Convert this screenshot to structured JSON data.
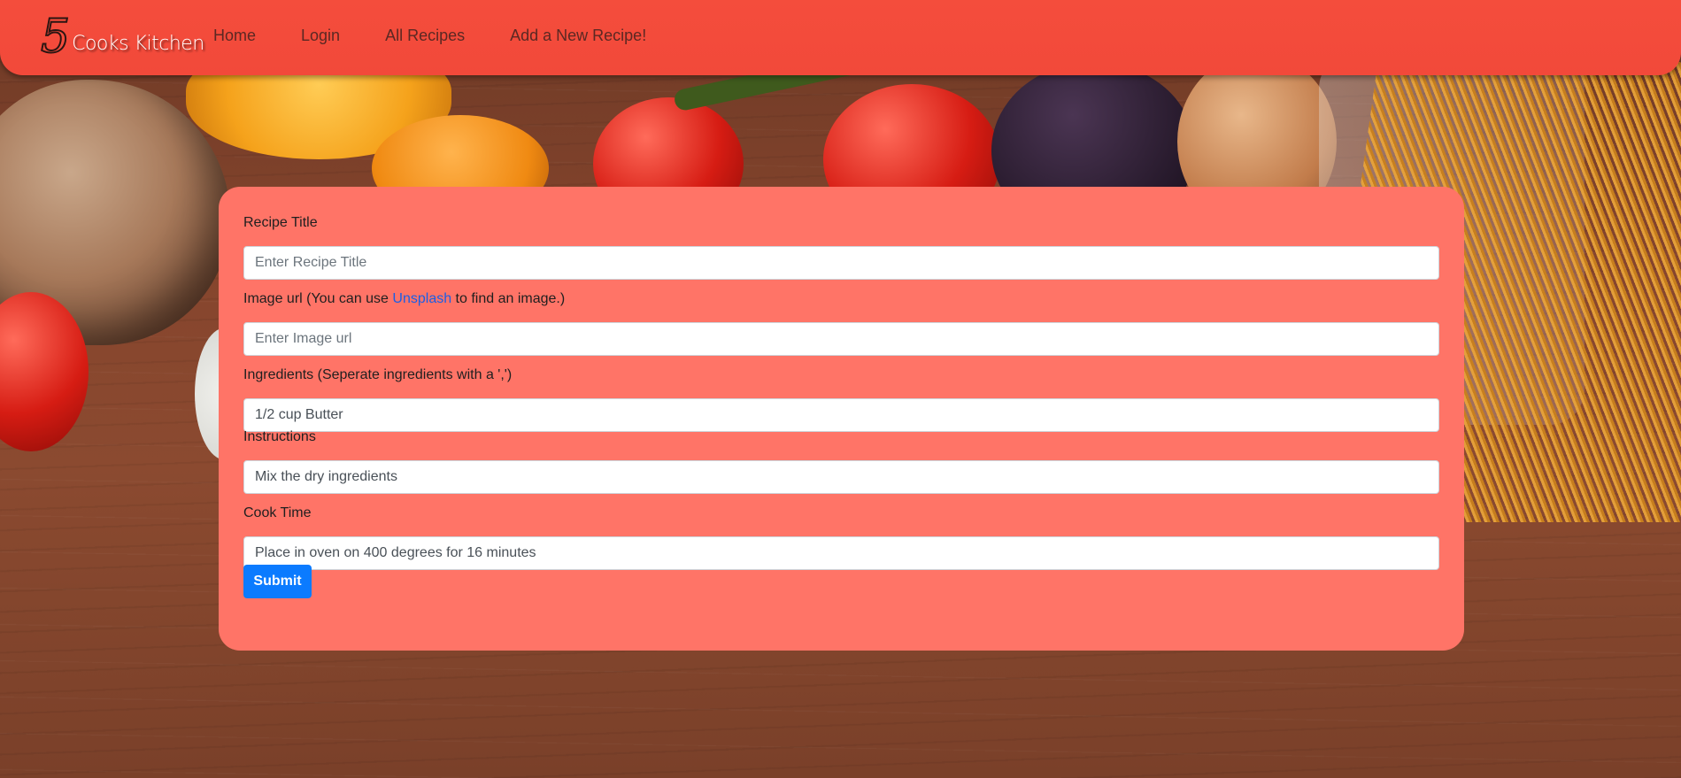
{
  "brand": {
    "number": "5",
    "name": "Cooks Kitchen"
  },
  "nav": {
    "items": [
      {
        "label": "Home"
      },
      {
        "label": "Login"
      },
      {
        "label": "All Recipes"
      },
      {
        "label": "Add a New Recipe!"
      }
    ]
  },
  "form": {
    "title": {
      "label": "Recipe Title",
      "placeholder": "Enter Recipe Title",
      "value": ""
    },
    "image": {
      "label_prefix": "Image url (You can use ",
      "label_link": "Unsplash",
      "label_suffix": " to find an image.)",
      "placeholder": "Enter Image url",
      "value": ""
    },
    "ingredients": {
      "label": "Ingredients (Seperate ingredients with a ',')",
      "value": "1/2 cup Butter"
    },
    "instructions": {
      "label": "Instructions",
      "value": "Mix the dry ingredients"
    },
    "cook_time": {
      "label": "Cook Time",
      "value": "Place in oven on 400 degrees for 16 minutes"
    },
    "submit_label": "Submit"
  },
  "colors": {
    "navbar": "#f44d3c",
    "card": "#ff7467",
    "submit": "#0b7bff",
    "link": "#1a5ee6"
  }
}
